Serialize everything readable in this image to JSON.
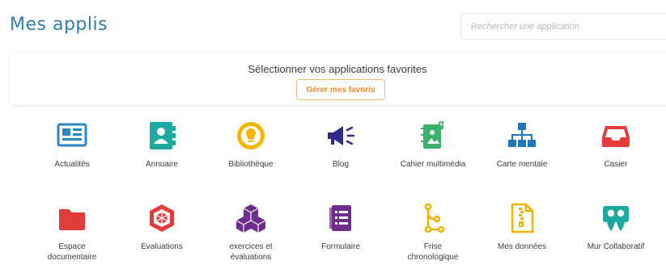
{
  "page": {
    "title": "Mes applis"
  },
  "search": {
    "placeholder": "Rechercher une application"
  },
  "favorites": {
    "title": "Sélectionner vos applications favorites",
    "button_label": "Gérer mes favoris"
  },
  "colors": {
    "title_blue": "#2e7fb0",
    "favorites_orange": "#ee8a32",
    "actualites": "#2b86c5",
    "annuaire": "#1ba9a0",
    "bibliotheque": "#f6b500",
    "blog": "#2d2a8c",
    "cahier": "#3cb36c",
    "carte": "#1f76b8",
    "casier": "#e53b3b",
    "espace": "#e23d3d",
    "evaluations": "#e23d3d",
    "exercices": "#6c2d8f",
    "formulaire": "#6c2d8f",
    "frise": "#f2b300",
    "donnees": "#f2b300",
    "mur": "#1ba9a0"
  },
  "apps": {
    "row1": [
      {
        "label": "Actualités",
        "icon": "newspaper-icon"
      },
      {
        "label": "Annuaire",
        "icon": "address-book-icon"
      },
      {
        "label": "Bibliothèque",
        "icon": "lightbulb-icon"
      },
      {
        "label": "Blog",
        "icon": "megaphone-icon"
      },
      {
        "label": "Cahier multimédia",
        "icon": "multimedia-notebook-icon"
      },
      {
        "label": "Carte mentale",
        "icon": "sitemap-icon"
      },
      {
        "label": "Casier",
        "icon": "inbox-tray-icon"
      }
    ],
    "row2": [
      {
        "label": "Espace\ndocumentaire",
        "icon": "folder-icon"
      },
      {
        "label": "Evaluations",
        "icon": "target-icon"
      },
      {
        "label": "exercices et\névaluations",
        "icon": "cubes-icon"
      },
      {
        "label": "Formulaire",
        "icon": "form-list-icon"
      },
      {
        "label": "Frise\nchronologique",
        "icon": "timeline-icon"
      },
      {
        "label": "Mes données",
        "icon": "file-zip-icon"
      },
      {
        "label": "Mur Collaboratif",
        "icon": "slideshare-icon"
      }
    ]
  }
}
